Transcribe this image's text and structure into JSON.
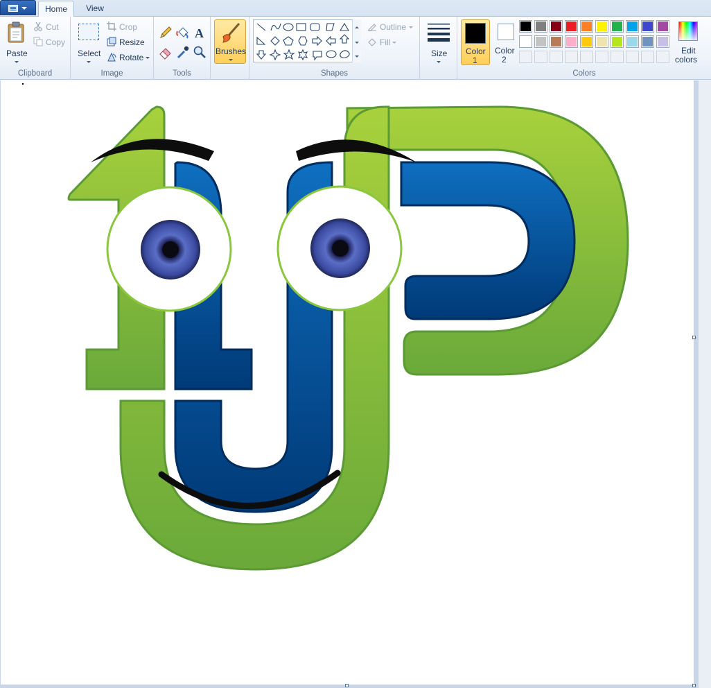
{
  "tabs": {
    "home": "Home",
    "view": "View"
  },
  "clipboard": {
    "paste": "Paste",
    "cut": "Cut",
    "copy": "Copy",
    "label": "Clipboard"
  },
  "image": {
    "select": "Select",
    "crop": "Crop",
    "resize": "Resize",
    "rotate": "Rotate",
    "label": "Image"
  },
  "tools": {
    "label": "Tools"
  },
  "brushes": {
    "label": "Brushes"
  },
  "shapes": {
    "outline": "Outline",
    "fill": "Fill",
    "label": "Shapes"
  },
  "size": {
    "label": "Size"
  },
  "colors": {
    "color1_line1": "Color",
    "color1_line2": "1",
    "color2_line1": "Color",
    "color2_line2": "2",
    "edit_line1": "Edit",
    "edit_line2": "colors",
    "label": "Colors",
    "color1_value": "#000000",
    "color2_value": "#ffffff",
    "palette_row1": [
      "#000000",
      "#7f7f7f",
      "#880015",
      "#ed1c24",
      "#ff7f27",
      "#fff200",
      "#22b14c",
      "#00a2e8",
      "#3f48cc",
      "#a349a4"
    ],
    "palette_row2": [
      "#ffffff",
      "#c3c3c3",
      "#b97a57",
      "#ffaec9",
      "#ffc90e",
      "#efe4b0",
      "#b5e61d",
      "#99d9ea",
      "#7092be",
      "#c8bfe7"
    ]
  },
  "artwork": {
    "name": "1UP logo face",
    "green": "#8cc63f",
    "blue": "#0a62b0",
    "dark_blue": "#003a78"
  }
}
